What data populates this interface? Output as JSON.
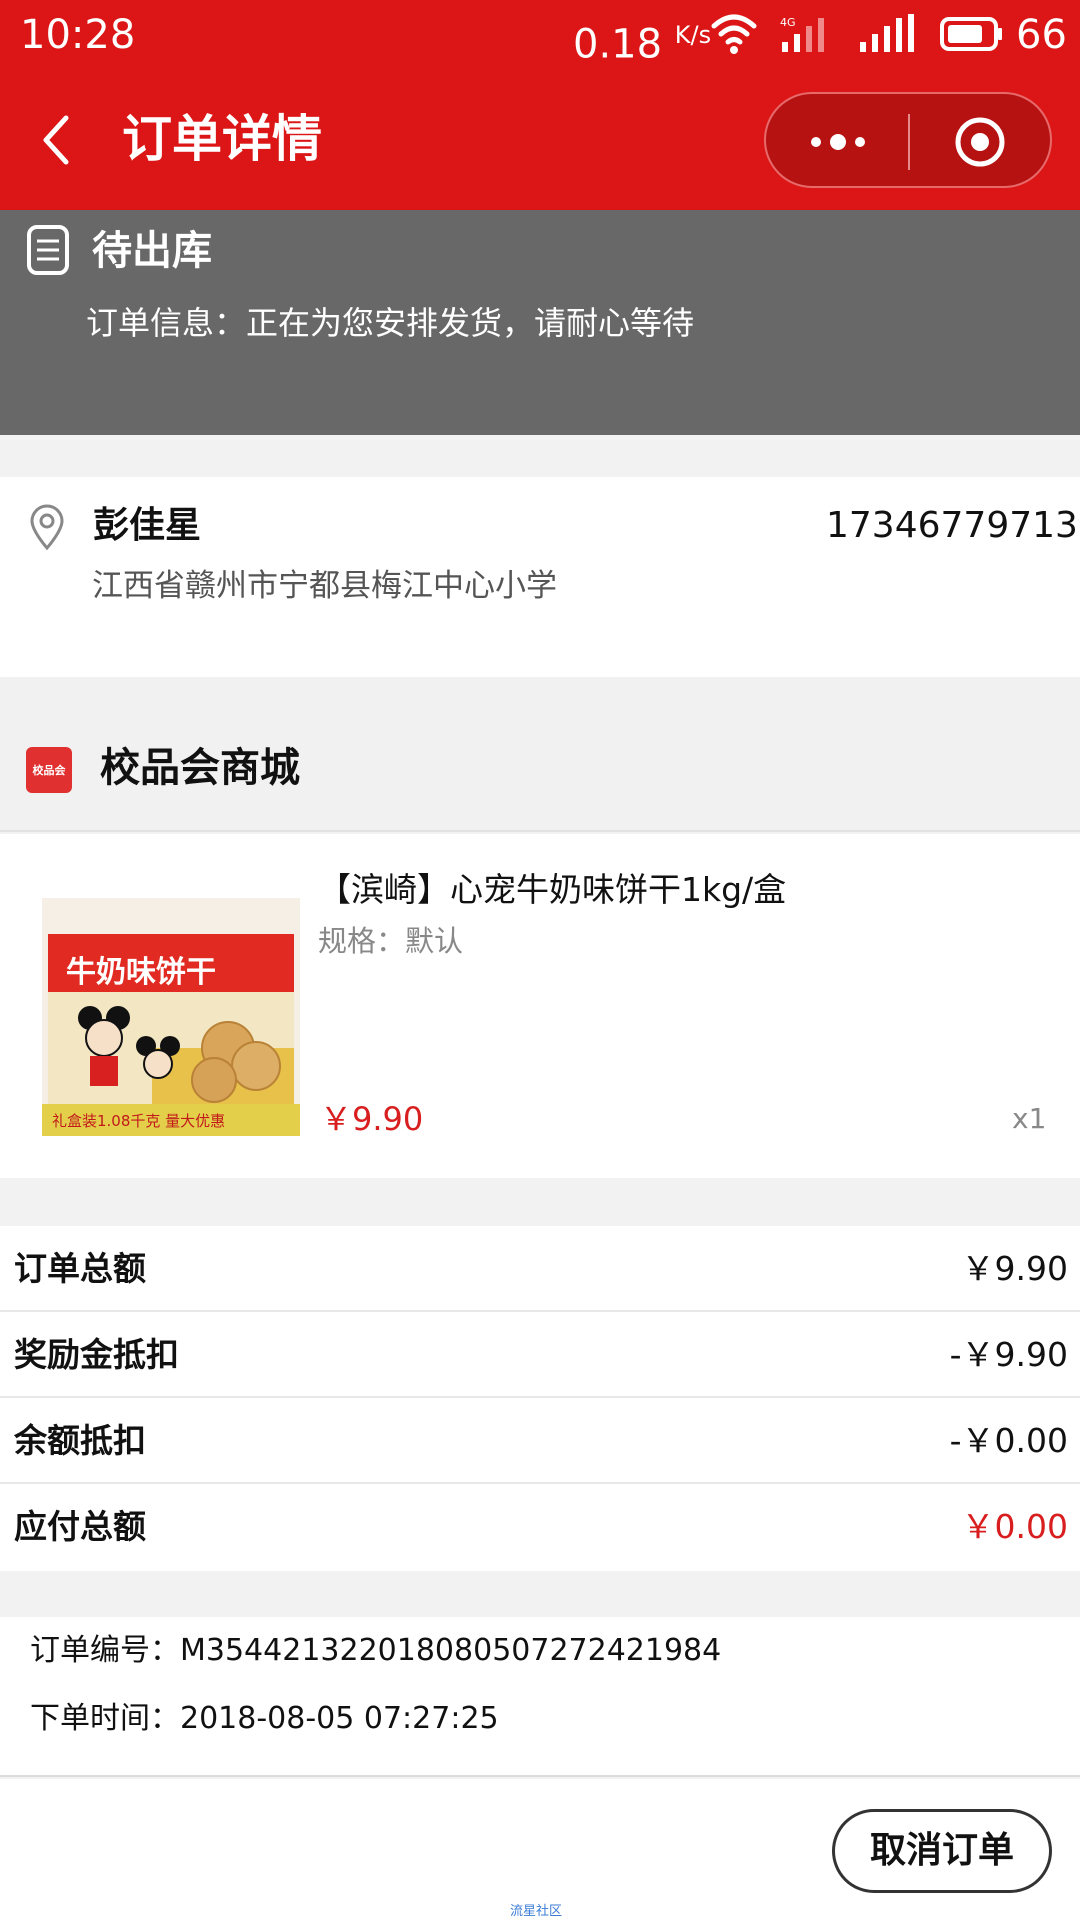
{
  "status_bar": {
    "time": "10:28",
    "speed": "0.18",
    "speed_unit": "K/s",
    "network": "4G",
    "battery": "66"
  },
  "nav": {
    "title": "订单详情"
  },
  "order_status": {
    "title": "待出库",
    "message": "订单信息：正在为您安排发货，请耐心等待"
  },
  "address": {
    "name": "彭佳星",
    "phone": "17346779713",
    "detail": "江西省赣州市宁都县梅江中心小学"
  },
  "shop": {
    "logo_text": "校品会",
    "name": "校品会商城"
  },
  "product": {
    "title": "【滨崎】心宠牛奶味饼干1kg/盒",
    "spec": "规格：默认",
    "price": "￥9.90",
    "quantity": "x1",
    "image_banner": "礼盒装1.08千克 量大优惠",
    "image_label": "牛奶味饼干"
  },
  "summary": {
    "rows": [
      {
        "label": "订单总额",
        "value": "￥9.90"
      },
      {
        "label": "奖励金抵扣",
        "value": "-￥9.90"
      },
      {
        "label": "余额抵扣",
        "value": "-￥0.00"
      },
      {
        "label": "应付总额",
        "value": "￥0.00"
      }
    ]
  },
  "order_info": {
    "number_label": "订单编号：",
    "number": "M354421322018080507272421984",
    "time_label": "下单时间：",
    "time": "2018-08-05 07:27:25"
  },
  "footer": {
    "cancel_label": "取消订单",
    "watermark": "流星社区"
  },
  "colors": {
    "brand_red": "#dc1616",
    "price_red": "#d81e1e",
    "status_gray": "#686868"
  }
}
